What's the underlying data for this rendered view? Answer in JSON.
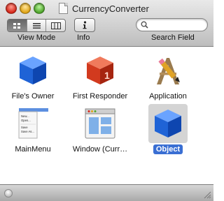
{
  "window": {
    "title": "CurrencyConverter"
  },
  "toolbar": {
    "view_mode_label": "View Mode",
    "info_label": "Info",
    "search_label": "Search Field",
    "search_placeholder": "",
    "view_modes": [
      "icon-view",
      "list-view",
      "column-view"
    ],
    "active_view_mode": "icon-view"
  },
  "objects": [
    {
      "label": "File's Owner",
      "icon": "blue-cube-icon"
    },
    {
      "label": "First Responder",
      "icon": "red-cube-icon"
    },
    {
      "label": "Application",
      "icon": "application-icon"
    },
    {
      "label": "MainMenu",
      "icon": "menu-icon"
    },
    {
      "label": "Window (Curr…",
      "icon": "window-icon"
    },
    {
      "label": "Object",
      "icon": "blue-cube-icon",
      "selected": true
    }
  ],
  "colors": {
    "selection": "#3a6fd3",
    "cube_blue": "#1f63d6",
    "cube_red": "#d23a1e"
  }
}
